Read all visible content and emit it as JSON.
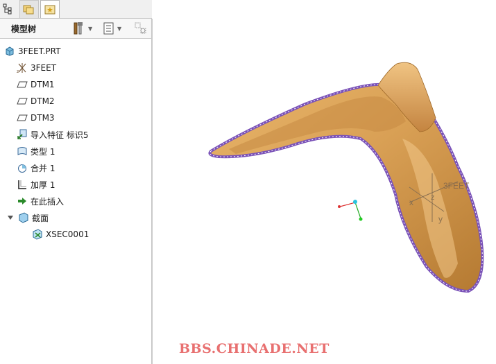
{
  "panel": {
    "title": "模型树"
  },
  "tree": {
    "root": "3FEET.PRT",
    "items": [
      {
        "label": "3FEET",
        "icon": "csys-icon"
      },
      {
        "label": "DTM1",
        "icon": "datum-plane-icon"
      },
      {
        "label": "DTM2",
        "icon": "datum-plane-icon"
      },
      {
        "label": "DTM3",
        "icon": "datum-plane-icon"
      },
      {
        "label": "导入特征 标识5",
        "icon": "import-feature-icon"
      },
      {
        "label": "类型 1",
        "icon": "style-surface-icon"
      },
      {
        "label": "合并 1",
        "icon": "merge-icon"
      },
      {
        "label": "加厚 1",
        "icon": "thicken-icon"
      },
      {
        "label": "在此插入",
        "icon": "insert-here-arrow-icon"
      },
      {
        "label": "截面",
        "icon": "section-folder-icon"
      },
      {
        "label": "XSEC0001",
        "icon": "section-icon"
      }
    ]
  },
  "viewport": {
    "csys_label": "3FEET",
    "axis_x": "x",
    "axis_y": "y",
    "axis_z": "z",
    "watermark": "BBS.CHINADE.NET"
  }
}
